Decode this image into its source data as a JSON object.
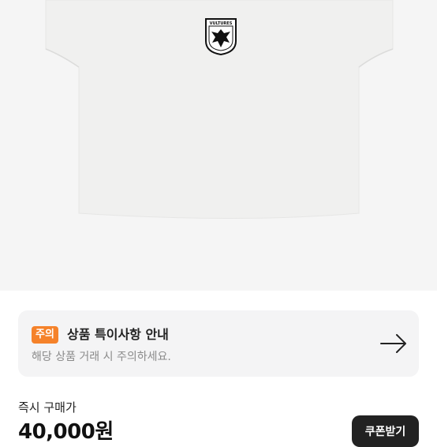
{
  "product": {
    "image_alt": "white cropped t-shirt with eagle crest",
    "crest_text": "VULTURES"
  },
  "notice": {
    "badge": "주의",
    "title": "상품 특이사항 안내",
    "description": "해당 상품 거래 시 주의하세요.",
    "arrow_icon": "arrow-right-icon"
  },
  "price": {
    "label": "즉시 구매가",
    "value": "40,000원"
  },
  "coupon": {
    "label": "쿠폰받기"
  },
  "colors": {
    "badge": "#f5822a",
    "card": "#f4f4f5",
    "image_bg": "#f5f5f5",
    "button": "#222222"
  }
}
